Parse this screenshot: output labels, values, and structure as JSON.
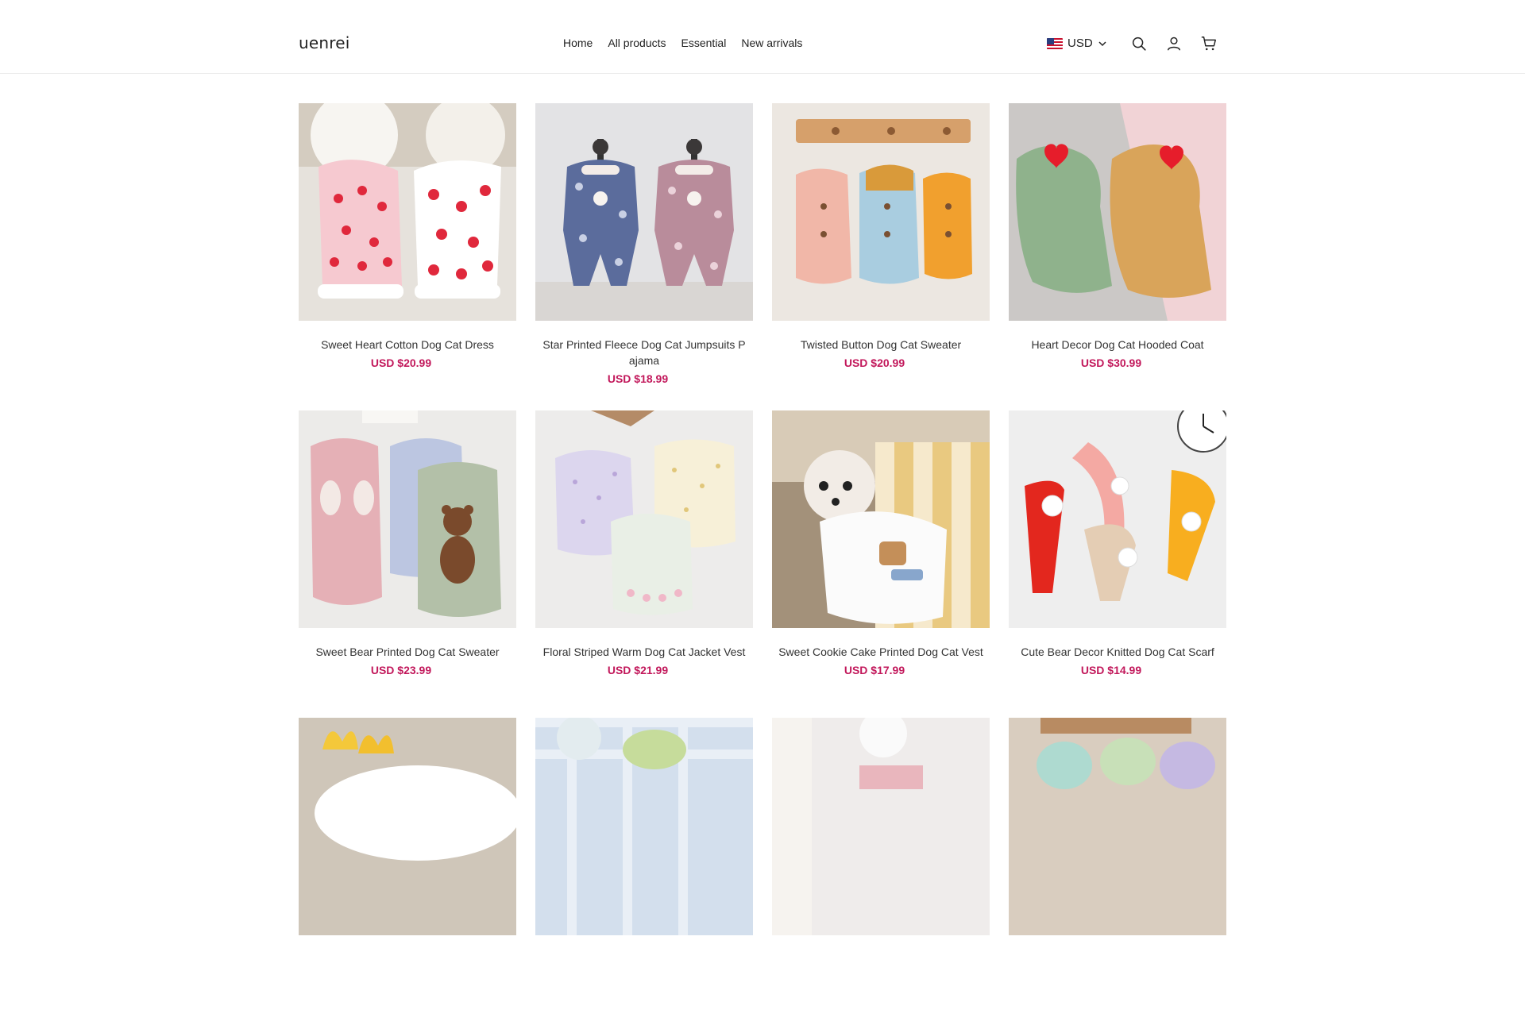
{
  "header": {
    "logo": "uenrei",
    "nav": [
      "Home",
      "All products",
      "Essential",
      "New arrivals"
    ],
    "currency": "USD",
    "icons": [
      "search-icon",
      "account-icon",
      "cart-icon"
    ]
  },
  "products": [
    {
      "title": "Sweet Heart Cotton Dog Cat Dress",
      "price": "USD $20.99"
    },
    {
      "title": "Star Printed Fleece Dog Cat Jumpsuits Pajama",
      "price": "USD $18.99"
    },
    {
      "title": "Twisted Button Dog Cat Sweater",
      "price": "USD $20.99"
    },
    {
      "title": "Heart Decor Dog Cat Hooded Coat",
      "price": "USD $30.99"
    },
    {
      "title": "Sweet Bear Printed Dog Cat Sweater",
      "price": "USD $23.99"
    },
    {
      "title": "Floral Striped Warm Dog Cat Jacket Vest",
      "price": "USD $21.99"
    },
    {
      "title": "Sweet Cookie Cake Printed Dog Cat Vest",
      "price": "USD $17.99"
    },
    {
      "title": "Cute Bear Decor Knitted Dog Cat Scarf",
      "price": "USD $14.99"
    }
  ],
  "colors": {
    "price": "#c2185b",
    "text": "#222222",
    "border": "#ececec"
  }
}
